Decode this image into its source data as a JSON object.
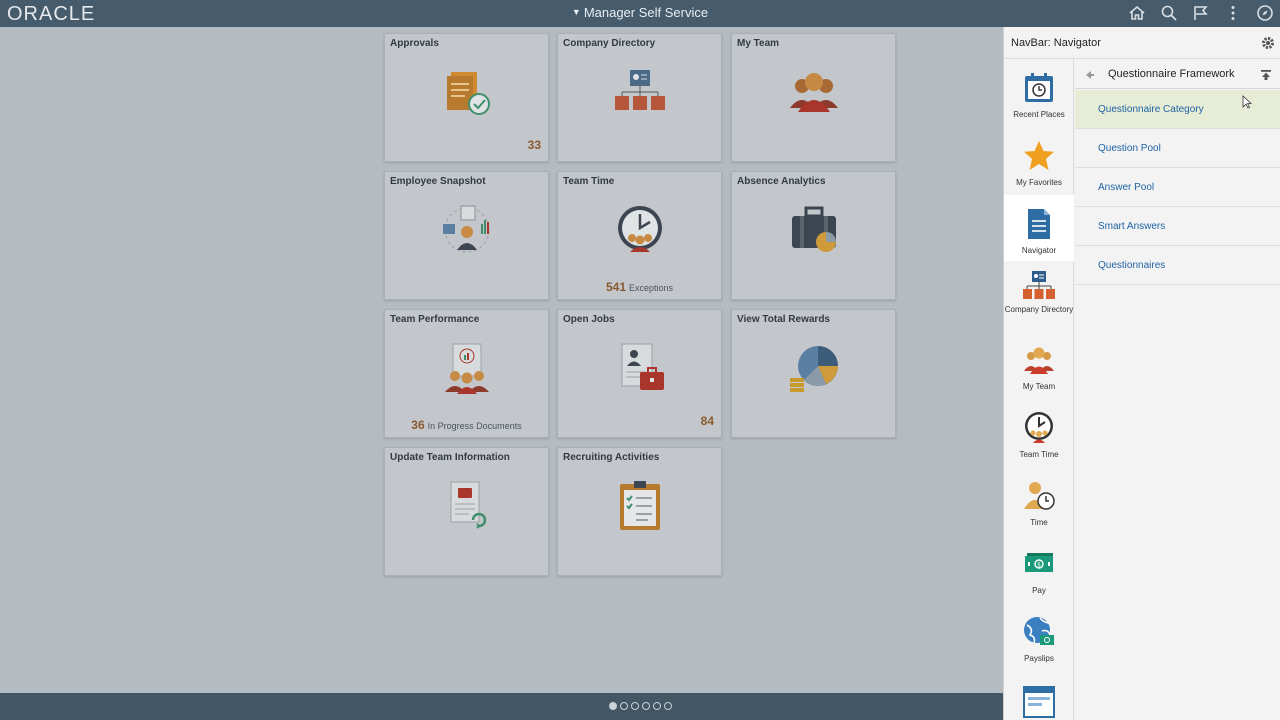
{
  "header": {
    "logo": "ORACLE",
    "title": "Manager Self Service",
    "icons": [
      "home-icon",
      "search-icon",
      "flag-icon",
      "more-icon",
      "navbar-icon"
    ]
  },
  "tiles": [
    {
      "title": "Approvals",
      "icon": "approvals-icon",
      "count": "33"
    },
    {
      "title": "Company Directory",
      "icon": "company-directory-icon"
    },
    {
      "title": "My Team",
      "icon": "my-team-icon"
    },
    {
      "title": "Employee Snapshot",
      "icon": "employee-snapshot-icon"
    },
    {
      "title": "Team Time",
      "icon": "team-time-icon",
      "count": "541",
      "count_label": "Exceptions"
    },
    {
      "title": "Absence Analytics",
      "icon": "absence-analytics-icon"
    },
    {
      "title": "Team Performance",
      "icon": "team-performance-icon",
      "count": "36",
      "count_label": "In Progress Documents"
    },
    {
      "title": "Open Jobs",
      "icon": "open-jobs-icon",
      "count": "84"
    },
    {
      "title": "View Total Rewards",
      "icon": "total-rewards-icon"
    },
    {
      "title": "Update Team Information",
      "icon": "update-team-icon"
    },
    {
      "title": "Recruiting Activities",
      "icon": "recruiting-icon"
    }
  ],
  "pager": {
    "pages": 6,
    "current": 1
  },
  "navbar": {
    "title": "NavBar: Navigator",
    "rail": [
      {
        "label": "Recent Places",
        "icon": "recent-places-icon"
      },
      {
        "label": "My Favorites",
        "icon": "star-icon"
      },
      {
        "label": "Navigator",
        "icon": "navigator-icon"
      },
      {
        "label": "Company Directory",
        "icon": "company-directory-icon"
      },
      {
        "label": "My Team",
        "icon": "my-team-icon"
      },
      {
        "label": "Team Time",
        "icon": "clock-icon"
      },
      {
        "label": "Time",
        "icon": "time-icon"
      },
      {
        "label": "Pay",
        "icon": "pay-icon"
      },
      {
        "label": "Payslips",
        "icon": "payslips-icon"
      }
    ],
    "breadcrumb": "Questionnaire Framework",
    "items": [
      "Questionnaire Category",
      "Question Pool",
      "Answer Pool",
      "Smart Answers",
      "Questionnaires"
    ]
  }
}
